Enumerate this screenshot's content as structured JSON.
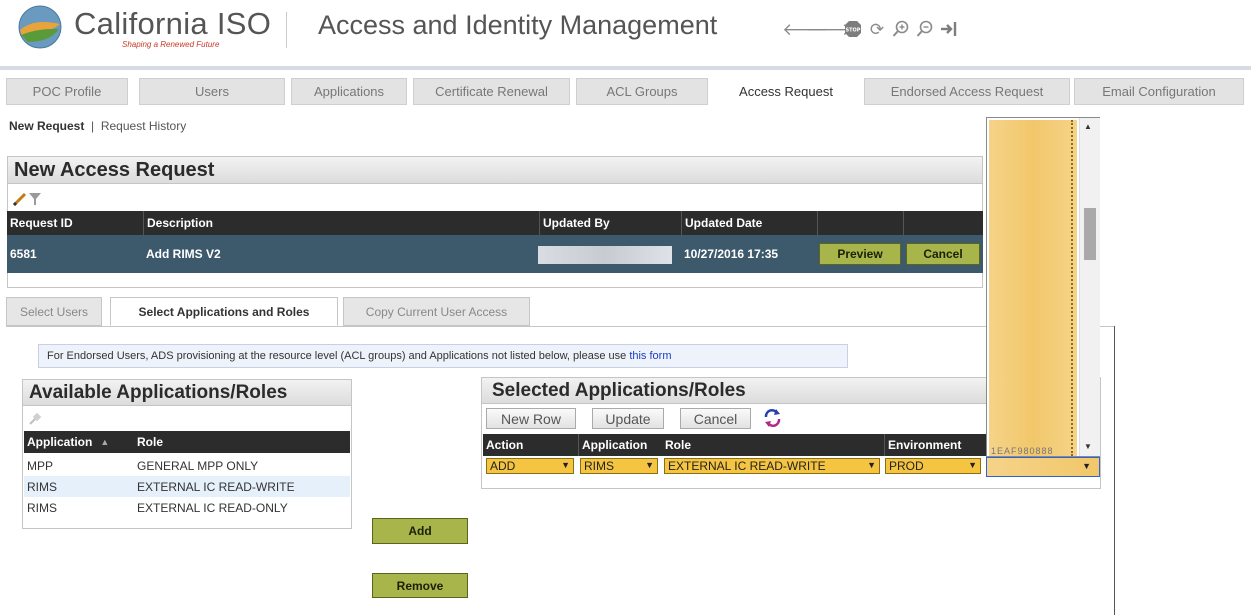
{
  "header": {
    "brand": "California ISO",
    "tagline": "Shaping a Renewed Future",
    "title": "Access and Identity Management",
    "icons": [
      "back-arrow-icon",
      "forward-arrow-icon",
      "stop-icon",
      "refresh-icon",
      "zoom-in-icon",
      "zoom-out-icon",
      "logout-icon"
    ],
    "stop_label": "STOP"
  },
  "tabs": [
    "POC Profile",
    "Users",
    "Applications",
    "Certificate Renewal",
    "ACL Groups",
    "Access Request",
    "Endorsed Access Request",
    "Email Configuration"
  ],
  "active_tab": "Access Request",
  "subnav": {
    "new_request": "New Request",
    "separator": "|",
    "history": "Request History"
  },
  "request_panel": {
    "title": "New Access Request",
    "columns": [
      "Request ID",
      "Description",
      "Updated By",
      "Updated Date"
    ],
    "row": {
      "id": "6581",
      "description": "Add RIMS V2",
      "updated_date": "10/27/2016 17:35"
    },
    "preview_label": "Preview",
    "cancel_label": "Cancel"
  },
  "subtabs": [
    "Select Users",
    "Select Applications and Roles",
    "Copy Current User Access"
  ],
  "active_subtab": "Select Applications and Roles",
  "notice": {
    "text": "For Endorsed Users, ADS provisioning at the resource level (ACL groups) and Applications not listed below, please use",
    "link": "this form"
  },
  "available": {
    "title": "Available Applications/Roles",
    "columns": [
      "Application",
      "Role"
    ],
    "rows": [
      {
        "application": "MPP",
        "role": "GENERAL MPP ONLY"
      },
      {
        "application": "RIMS",
        "role": "EXTERNAL IC READ-WRITE"
      },
      {
        "application": "RIMS",
        "role": "EXTERNAL IC READ-ONLY"
      }
    ]
  },
  "actions": {
    "add": "Add",
    "remove": "Remove"
  },
  "selected": {
    "title": "Selected Applications/Roles",
    "buttons": {
      "new_row": "New Row",
      "update": "Update",
      "cancel": "Cancel"
    },
    "columns": [
      "Action",
      "Application",
      "Role",
      "Environment"
    ],
    "row": {
      "action": "ADD",
      "application": "RIMS",
      "role": "EXTERNAL IC READ-WRITE",
      "environment": "PROD"
    }
  },
  "dropdown": {
    "partial_text": "1EAF980888"
  },
  "colors": {
    "grid_header": "#2c2c2c",
    "selected_row": "#3d5a6c",
    "olive_button": "#a7b54b",
    "select_yellow": "#f5c542",
    "dropdown_yellow": "#f3d078"
  }
}
